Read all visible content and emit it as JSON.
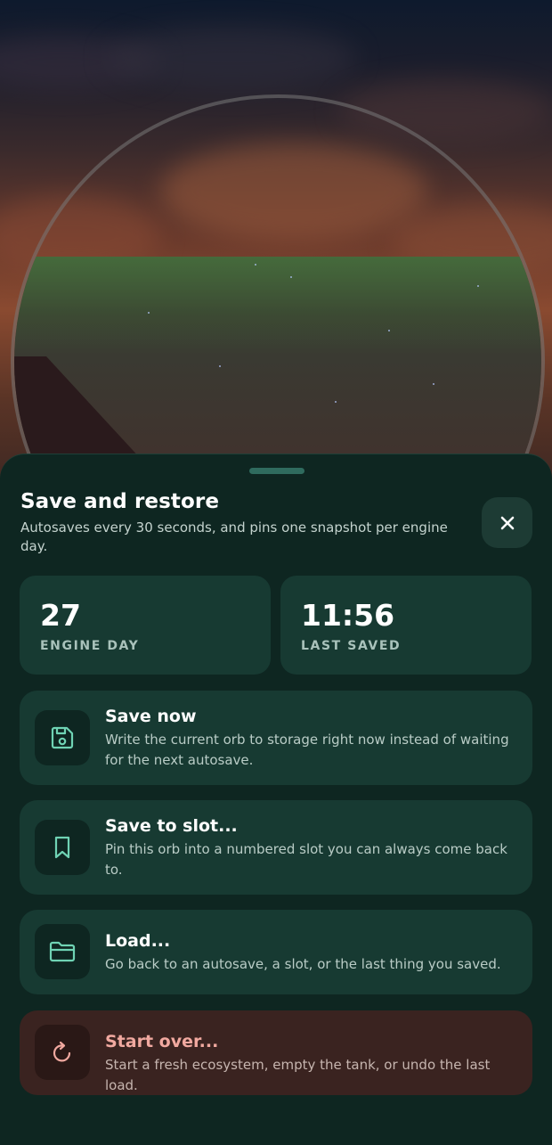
{
  "sheet": {
    "title": "Save and restore",
    "subtitle": "Autosaves every 30 seconds, and pins one snapshot per engine day.",
    "close_icon": "close-icon"
  },
  "stats": {
    "engine_day": {
      "value": "27",
      "label": "ENGINE DAY"
    },
    "last_saved": {
      "value": "11:56",
      "label": "LAST SAVED"
    }
  },
  "actions": [
    {
      "title": "Save now",
      "description": "Write the current orb to storage right now instead of waiting for the next autosave.",
      "icon": "floppy-disk-icon"
    },
    {
      "title": "Save to slot...",
      "description": "Pin this orb into a numbered slot you can always come back to.",
      "icon": "bookmark-icon"
    },
    {
      "title": "Load...",
      "description": "Go back to an autosave, a slot, or the last thing you saved.",
      "icon": "folder-icon"
    },
    {
      "title": "Start over...",
      "description": "Start a fresh ecosystem, empty the tank, or undo the last load.",
      "icon": "restart-icon"
    }
  ],
  "colors": {
    "accent": "#6fd3b4",
    "danger": "#f1a9a0",
    "sheet_bg": "#0e2621",
    "card_bg": "#173a32"
  }
}
